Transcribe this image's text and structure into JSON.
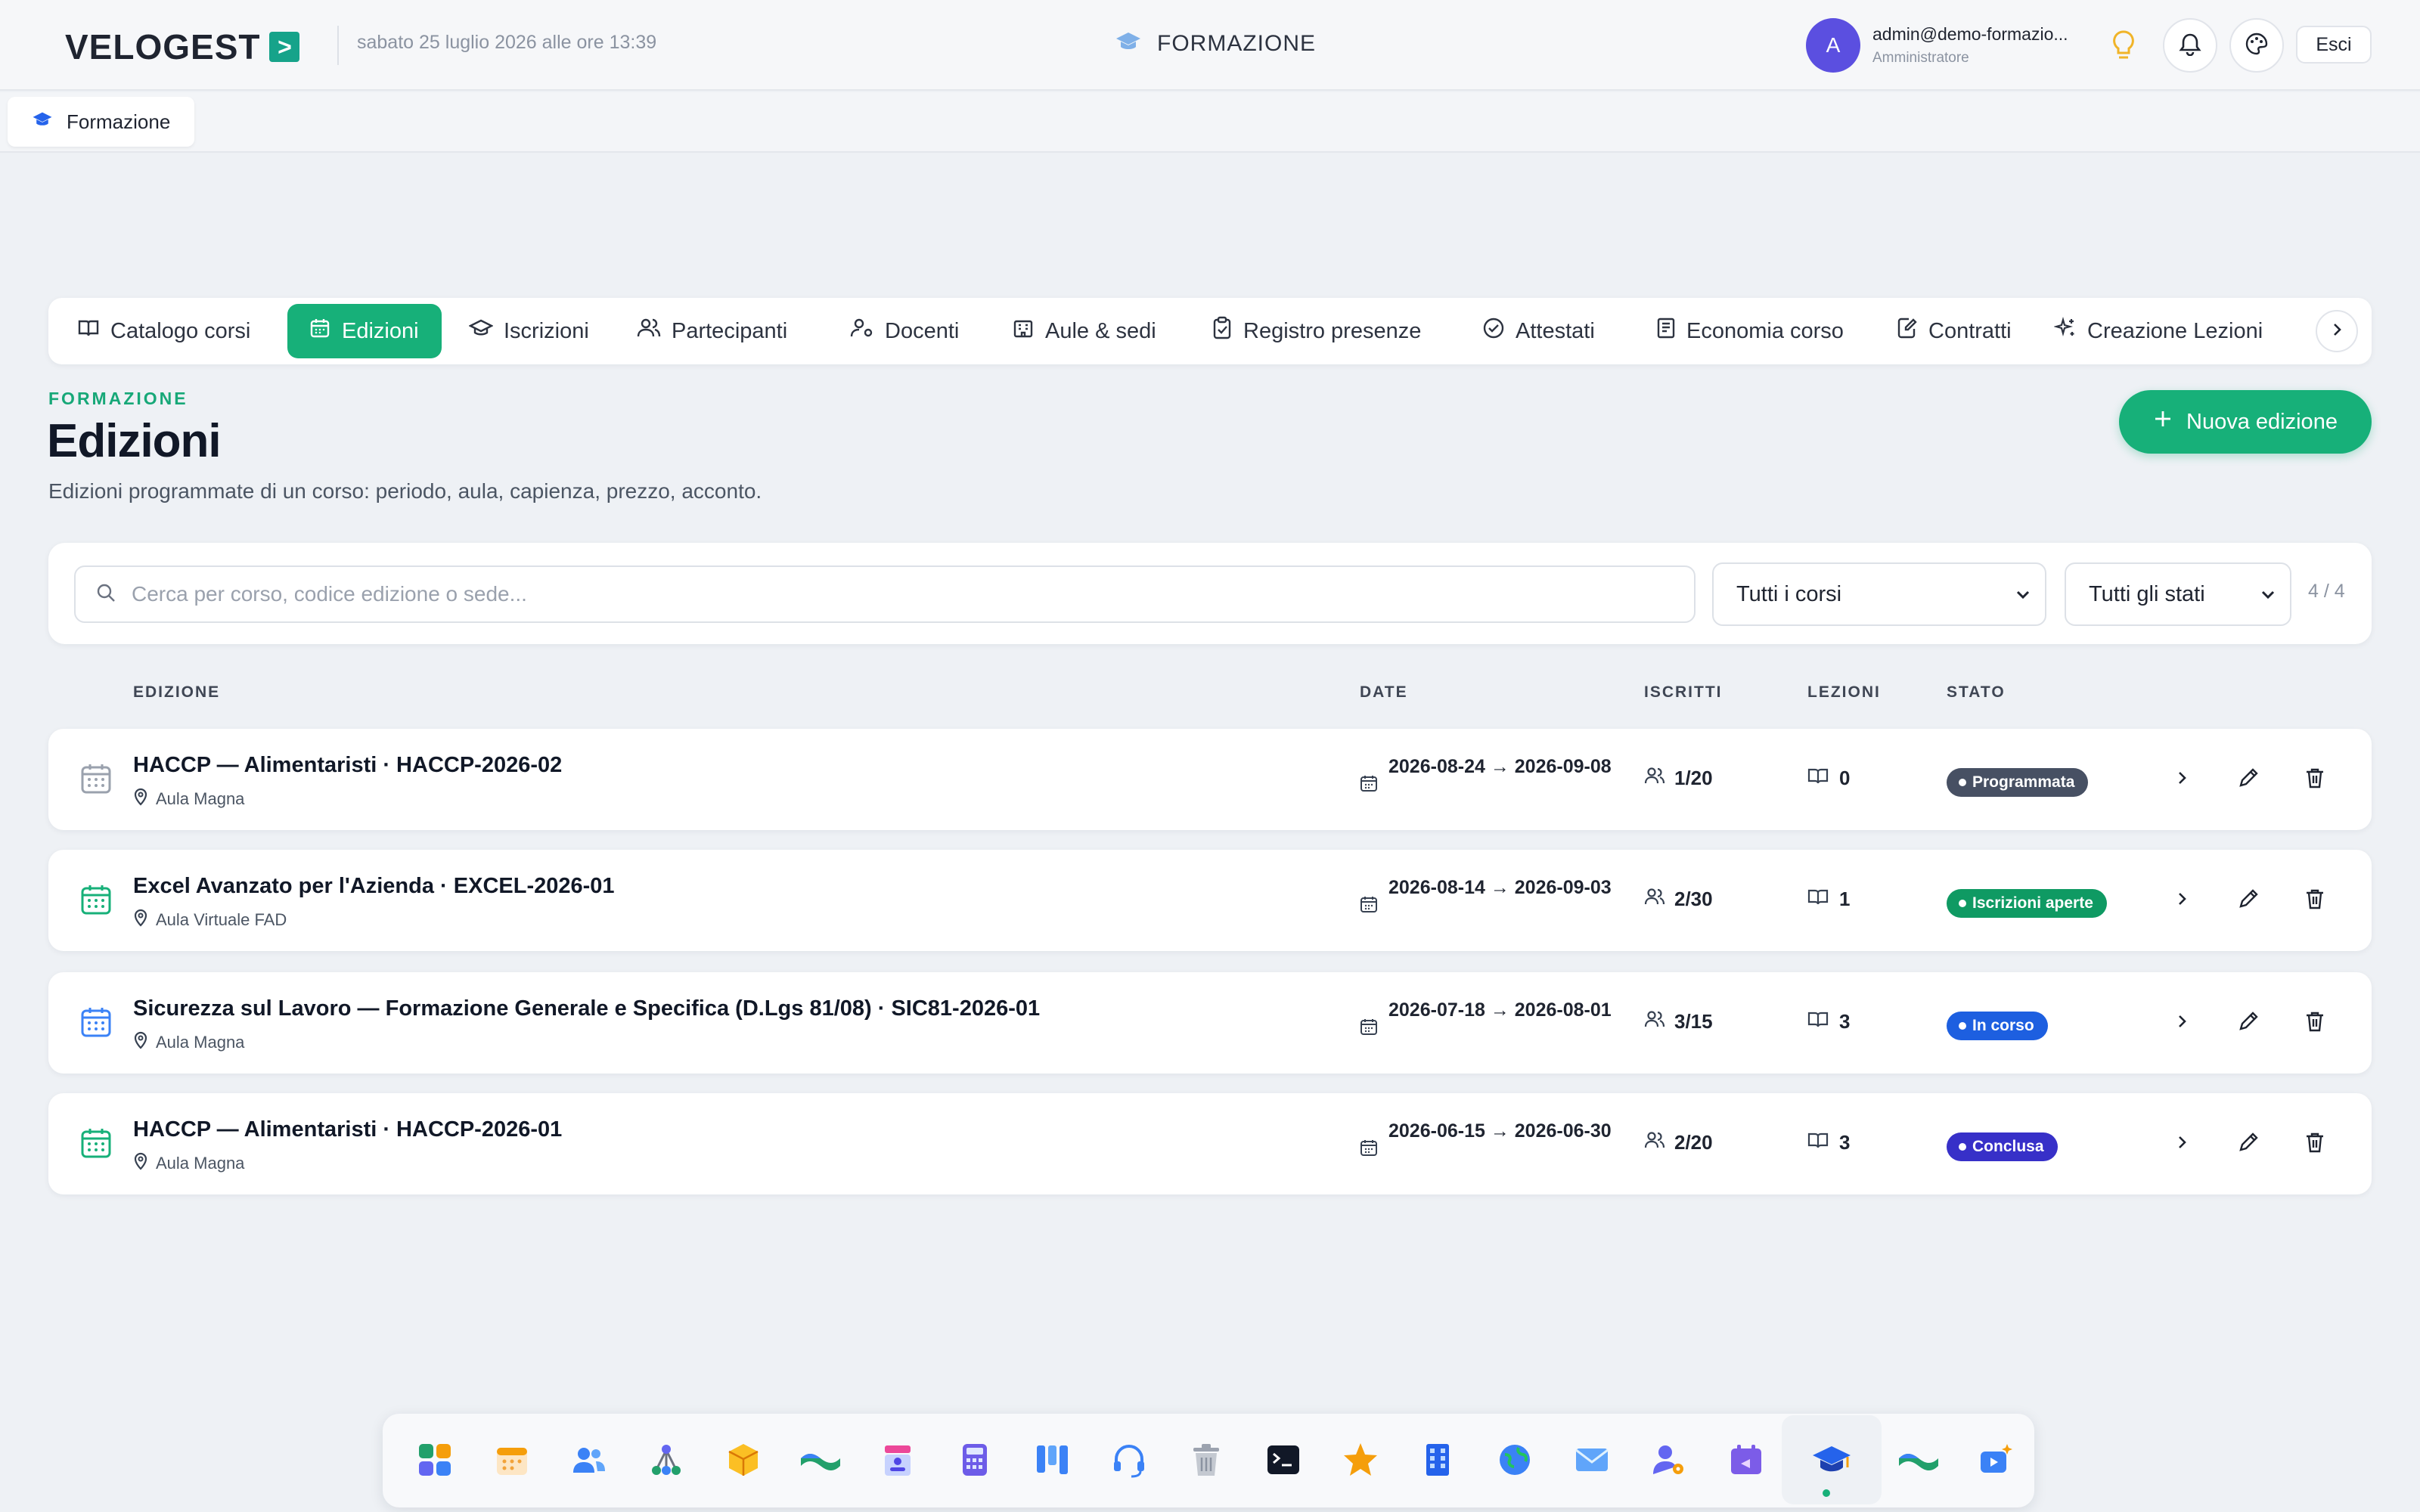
{
  "app": {
    "logo": "VELOGEST",
    "logo_mark": ">",
    "datetime": "sabato 25 luglio 2026 alle ore 13:39",
    "module": "FORMAZIONE",
    "user": {
      "initial": "A",
      "email": "admin@demo-formazio...",
      "role": "Amministratore"
    },
    "logout_label": "Esci"
  },
  "open_tab": {
    "label": "Formazione"
  },
  "nav": {
    "items": [
      {
        "label": "Catalogo corsi",
        "icon": "book-icon",
        "active": false
      },
      {
        "label": "Edizioni",
        "icon": "calendar-icon",
        "active": true
      },
      {
        "label": "Iscrizioni",
        "icon": "graduation-cap-icon",
        "active": false
      },
      {
        "label": "Partecipanti",
        "icon": "users-icon",
        "active": false
      },
      {
        "label": "Docenti",
        "icon": "user-cog-icon",
        "active": false
      },
      {
        "label": "Aule & sedi",
        "icon": "building-icon",
        "active": false
      },
      {
        "label": "Registro presenze",
        "icon": "clipboard-check-icon",
        "active": false
      },
      {
        "label": "Attestati",
        "icon": "check-circle-icon",
        "active": false
      },
      {
        "label": "Economia corso",
        "icon": "receipt-icon",
        "active": false
      },
      {
        "label": "Contratti",
        "icon": "file-edit-icon",
        "active": false
      },
      {
        "label": "Creazione Lezioni",
        "icon": "sparkles-icon",
        "active": false
      }
    ]
  },
  "header": {
    "eyebrow": "FORMAZIONE",
    "title": "Edizioni",
    "subtitle": "Edizioni programmate di un corso: periodo, aula, capienza, prezzo, acconto.",
    "new_button": "Nuova edizione"
  },
  "filters": {
    "search_placeholder": "Cerca per corso, codice edizione o sede...",
    "course_select": "Tutti i corsi",
    "status_select": "Tutti gli stati",
    "count": "4 / 4"
  },
  "table": {
    "columns": [
      "EDIZIONE",
      "DATE",
      "ISCRITTI",
      "LEZIONI",
      "STATO"
    ],
    "rows": [
      {
        "title": "HACCP — Alimentaristi · HACCP-2026-02",
        "location": "Aula Magna",
        "dates": "2026-08-24 → 2026-09-08",
        "enrolled": "1/20",
        "lessons": "0",
        "status": "Programmata",
        "status_color": "#475063",
        "icon_color": "#9aa1ad"
      },
      {
        "title": "Excel Avanzato per l'Azienda · EXCEL-2026-01",
        "location": "Aula Virtuale FAD",
        "dates": "2026-08-14 → 2026-09-03",
        "enrolled": "2/30",
        "lessons": "1",
        "status": "Iscrizioni aperte",
        "status_color": "#0f9a63",
        "icon_color": "#17b079"
      },
      {
        "title": "Sicurezza sul Lavoro — Formazione Generale e Specifica (D.Lgs 81/08) · SIC81-2026-01",
        "location": "Aula Magna",
        "dates": "2026-07-18 → 2026-08-01",
        "enrolled": "3/15",
        "lessons": "3",
        "status": "In corso",
        "status_color": "#1d5fe0",
        "icon_color": "#3b82f6"
      },
      {
        "title": "HACCP — Alimentaristi · HACCP-2026-01",
        "location": "Aula Magna",
        "dates": "2026-06-15 → 2026-06-30",
        "enrolled": "2/20",
        "lessons": "3",
        "status": "Conclusa",
        "status_color": "#3730c8",
        "icon_color": "#17b079"
      }
    ]
  },
  "dock": {
    "items": [
      "apps-grid-icon",
      "calendar-icon",
      "people-icon",
      "network-icon",
      "package-icon",
      "handshake-icon",
      "contact-card-icon",
      "calculator-icon",
      "kanban-icon",
      "headset-icon",
      "trash-icon",
      "terminal-icon",
      "star-icon",
      "office-building-icon",
      "globe-icon",
      "mail-icon",
      "user-settings-icon",
      "calendar-clock-icon",
      "graduation-cap-icon",
      "handshake-icon",
      "video-sparkle-icon"
    ],
    "active": "graduation-cap-icon"
  },
  "colors": {
    "accent": "#17b079",
    "eyebrow": "#17a878",
    "avatar": "#5b4fe0"
  }
}
